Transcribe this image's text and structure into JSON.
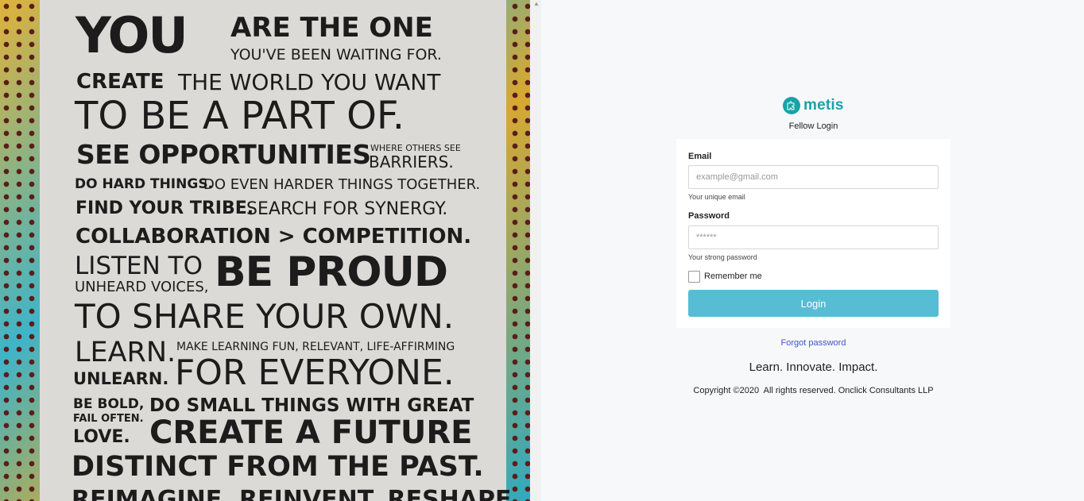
{
  "poster": {
    "lines": [
      "YOU",
      "ARE THE ONE",
      "YOU'VE BEEN WAITING FOR.",
      "CREATE",
      "THE WORLD YOU WANT",
      "TO BE A PART OF.",
      "SEE OPPORTUNITIES",
      "WHERE OTHERS SEE",
      "BARRIERS.",
      "DO HARD THINGS.",
      "DO EVEN HARDER THINGS TOGETHER.",
      "FIND YOUR TRIBE.",
      "SEARCH FOR SYNERGY.",
      "COLLABORATION > COMPETITION.",
      "LISTEN TO",
      "UNHEARD VOICES,",
      "BE PROUD",
      "TO SHARE YOUR OWN.",
      "LEARN.",
      "MAKE LEARNING FUN, RELEVANT, LIFE-AFFIRMING",
      "UNLEARN.",
      "FOR EVERYONE.",
      "BE BOLD,",
      "FAIL OFTEN.",
      "LOVE.",
      "DO SMALL THINGS WITH GREAT",
      "CREATE A FUTURE",
      "DISTINCT FROM THE PAST.",
      "REIMAGINE. REINVENT. RESHAPE."
    ]
  },
  "brand": {
    "name": "metis",
    "color": "#17a3a8",
    "icon": "puzzle-logo-icon"
  },
  "login": {
    "subtitle": "Fellow Login",
    "email_label": "Email",
    "email_placeholder": "example@gmail.com",
    "email_help": "Your unique email",
    "password_label": "Password",
    "password_placeholder": "******",
    "password_help": "Your strong password",
    "remember_label": "Remember me",
    "login_button": "Login",
    "button_color": "#56bdd4"
  },
  "footer": {
    "forgot": "Forgot password",
    "tagline": "Learn. Innovate. Impact.",
    "copyright": "Copyright ©2020  All rights reserved. Onclick Consultants LLP"
  }
}
